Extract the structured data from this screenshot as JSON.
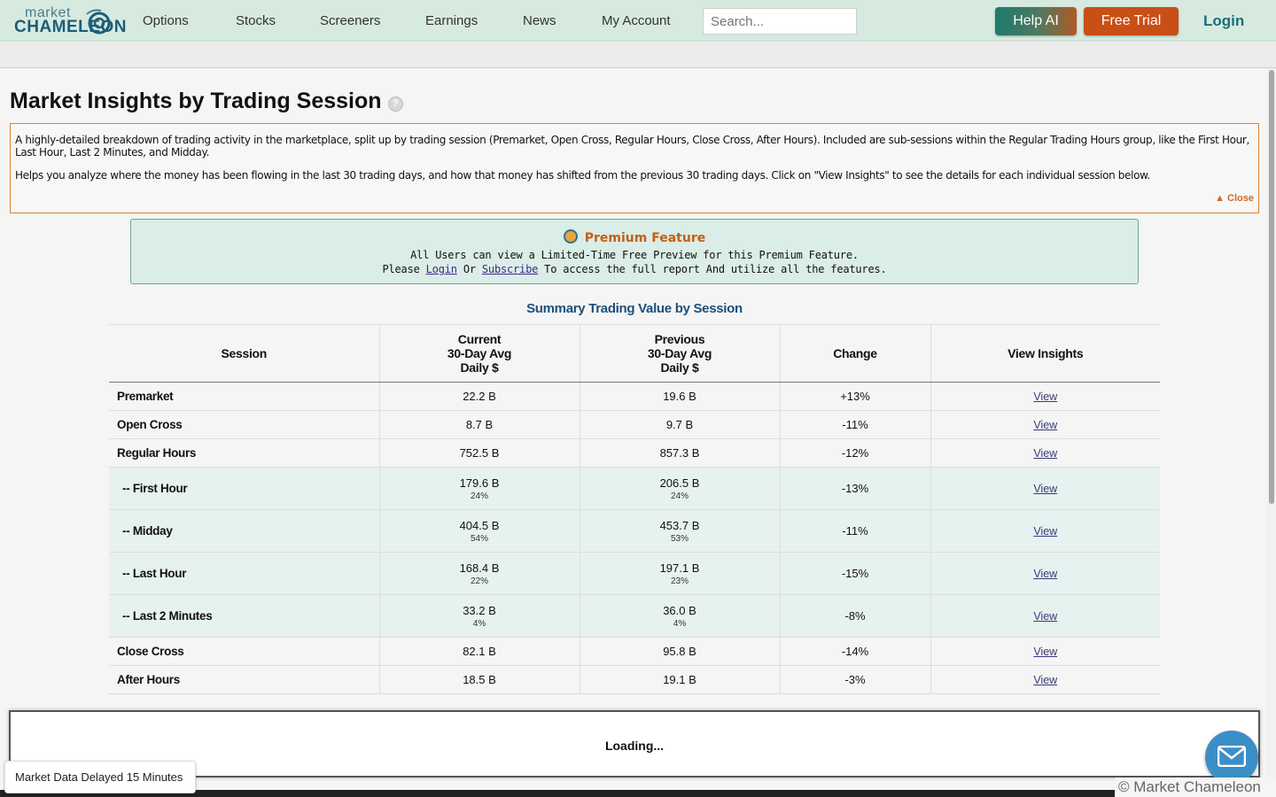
{
  "logo": {
    "line1": "market",
    "line2": "CHAMELEON"
  },
  "nav": {
    "items": [
      "Options",
      "Stocks",
      "Screeners",
      "Earnings",
      "News",
      "My Account"
    ],
    "search_placeholder": "Search...",
    "help_ai": "Help AI",
    "free_trial": "Free Trial",
    "login": "Login"
  },
  "page": {
    "title": "Market Insights by Trading Session",
    "help_icon": "?",
    "description_1": "A highly-detailed breakdown of trading activity in the marketplace, split up by trading session (Premarket, Open Cross, Regular Hours, Close Cross, After Hours). Included are sub-sessions within the Regular Trading Hours group, like the First Hour, Last Hour, Last 2 Minutes, and Midday.",
    "description_2": "Helps you analyze where the money has been flowing in the last 30 trading days, and how that money has shifted from the previous 30 trading days. Click on \"View Insights\" to see the details for each individual session below.",
    "close_label": "▲ Close"
  },
  "premium": {
    "title": "Premium Feature",
    "line1": "All Users can view a Limited-Time Free Preview for this Premium Feature.",
    "please": "Please",
    "login": "Login",
    "or": "Or",
    "subscribe": "Subscribe",
    "rest": "To access the full report And utilize all the features."
  },
  "table": {
    "title": "Summary Trading Value by Session",
    "headers": {
      "session": "Session",
      "current": [
        "Current",
        "30-Day Avg",
        "Daily $"
      ],
      "previous": [
        "Previous",
        "30-Day Avg",
        "Daily $"
      ],
      "change": "Change",
      "view": "View Insights"
    },
    "rows": [
      {
        "name": "Premarket",
        "current": "22.2 B",
        "previous": "19.6 B",
        "change": "+13%",
        "view": "View"
      },
      {
        "name": "Open Cross",
        "current": "8.7 B",
        "previous": "9.7 B",
        "change": "-11%",
        "view": "View"
      },
      {
        "name": "Regular Hours",
        "current": "752.5 B",
        "previous": "857.3 B",
        "change": "-12%",
        "view": "View"
      },
      {
        "name": "-- First Hour",
        "current": "179.6 B",
        "current_pct": "24%",
        "previous": "206.5 B",
        "previous_pct": "24%",
        "change": "-13%",
        "view": "View"
      },
      {
        "name": "-- Midday",
        "current": "404.5 B",
        "current_pct": "54%",
        "previous": "453.7 B",
        "previous_pct": "53%",
        "change": "-11%",
        "view": "View"
      },
      {
        "name": "-- Last Hour",
        "current": "168.4 B",
        "current_pct": "22%",
        "previous": "197.1 B",
        "previous_pct": "23%",
        "change": "-15%",
        "view": "View"
      },
      {
        "name": "-- Last 2 Minutes",
        "current": "33.2 B",
        "current_pct": "4%",
        "previous": "36.0 B",
        "previous_pct": "4%",
        "change": "-8%",
        "view": "View"
      },
      {
        "name": "Close Cross",
        "current": "82.1 B",
        "previous": "95.8 B",
        "change": "-14%",
        "view": "View"
      },
      {
        "name": "After Hours",
        "current": "18.5 B",
        "previous": "19.1 B",
        "change": "-3%",
        "view": "View"
      }
    ]
  },
  "footer": {
    "loading": "Loading...",
    "delayed": "Market Data Delayed 15 Minutes",
    "copyright": "© Market Chameleon"
  },
  "colors": {
    "positive": "#2a8a2a",
    "negative": "#c01818",
    "accent": "#c94f16"
  }
}
